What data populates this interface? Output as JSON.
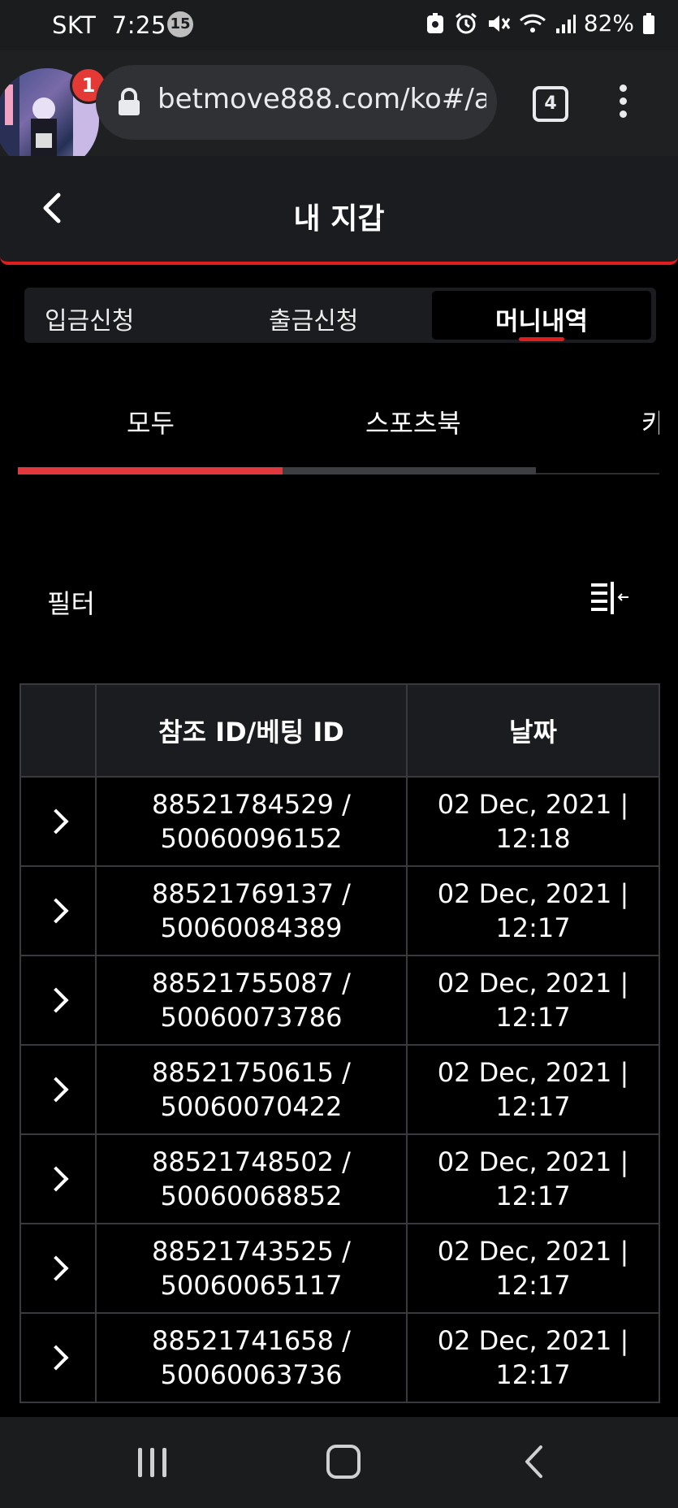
{
  "status_bar": {
    "carrier": "SKT",
    "time": "7:25",
    "notification_count": "15",
    "battery": "82%"
  },
  "browser": {
    "url": "betmove888.com/ko#/a",
    "notification_badge": "1",
    "tab_count": "4"
  },
  "page": {
    "title": "내 지갑"
  },
  "wallet_tabs": [
    "입금신청",
    "출금신청",
    "머니내역"
  ],
  "active_wallet_tab": "머니내역",
  "sub_tabs": [
    "모두",
    "스포츠북",
    "카"
  ],
  "active_sub_tab": "모두",
  "filter": {
    "label": "필터"
  },
  "table": {
    "headers": [
      "",
      "참조 ID/베팅 ID",
      "날짜"
    ],
    "rows": [
      {
        "ref_id": "88521784529 /",
        "bet_id": "50060096152",
        "date": "02 Dec, 2021 |",
        "time": "12:18"
      },
      {
        "ref_id": "88521769137 /",
        "bet_id": "50060084389",
        "date": "02 Dec, 2021 |",
        "time": "12:17"
      },
      {
        "ref_id": "88521755087 /",
        "bet_id": "50060073786",
        "date": "02 Dec, 2021 |",
        "time": "12:17"
      },
      {
        "ref_id": "88521750615 /",
        "bet_id": "50060070422",
        "date": "02 Dec, 2021 |",
        "time": "12:17"
      },
      {
        "ref_id": "88521748502 /",
        "bet_id": "50060068852",
        "date": "02 Dec, 2021 |",
        "time": "12:17"
      },
      {
        "ref_id": "88521743525 /",
        "bet_id": "50060065117",
        "date": "02 Dec, 2021 |",
        "time": "12:17"
      },
      {
        "ref_id": "88521741658 /",
        "bet_id": "50060063736",
        "date": "02 Dec, 2021 |",
        "time": "12:17"
      }
    ]
  },
  "colors": {
    "accent": "#e01e1e",
    "background": "#000000",
    "panel": "#1b1c20",
    "grid_border": "#3a3a3e"
  },
  "icons": [
    "lock-icon",
    "back-arrow-icon",
    "filter-icon",
    "chevron-right-icon",
    "kebab-menu-icon",
    "nav-recents-icon",
    "nav-home-icon",
    "nav-back-icon"
  ]
}
